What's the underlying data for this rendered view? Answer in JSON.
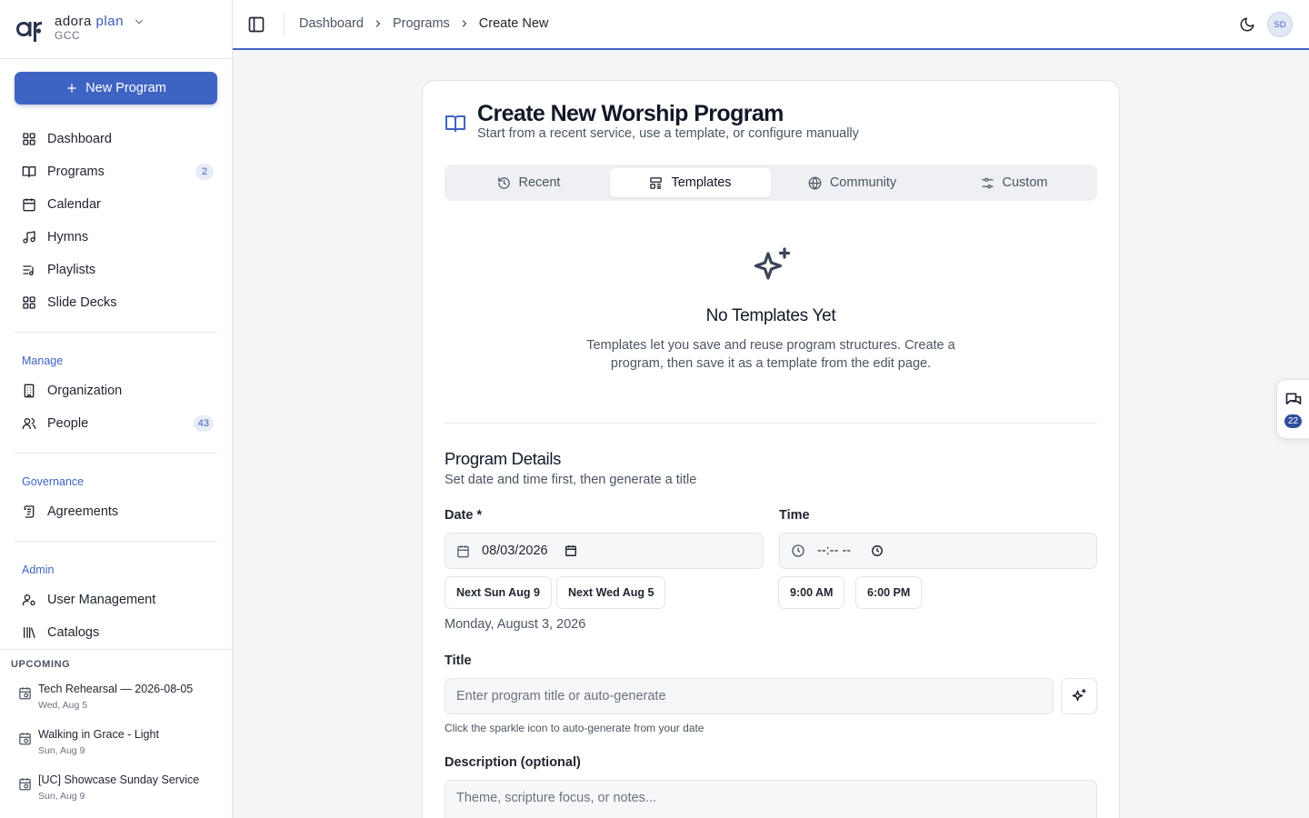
{
  "brand": {
    "name_main": "adora",
    "name_accent": "plan",
    "org": "GCC"
  },
  "sidebar": {
    "new_program": "New Program",
    "main_items": [
      {
        "label": "Dashboard",
        "icon": "grid-icon"
      },
      {
        "label": "Programs",
        "icon": "book-icon",
        "badge": "2"
      },
      {
        "label": "Calendar",
        "icon": "calendar-icon"
      },
      {
        "label": "Hymns",
        "icon": "music-icon"
      },
      {
        "label": "Playlists",
        "icon": "playlist-icon"
      },
      {
        "label": "Slide Decks",
        "icon": "grid-icon"
      }
    ],
    "manage_label": "Manage",
    "manage_items": [
      {
        "label": "Organization",
        "icon": "building-icon"
      },
      {
        "label": "People",
        "icon": "users-icon",
        "badge": "43"
      }
    ],
    "governance_label": "Governance",
    "governance_items": [
      {
        "label": "Agreements",
        "icon": "scroll-icon"
      }
    ],
    "admin_label": "Admin",
    "admin_items": [
      {
        "label": "User Management",
        "icon": "user-cog-icon"
      },
      {
        "label": "Catalogs",
        "icon": "library-icon"
      }
    ],
    "upcoming_label": "UPCOMING",
    "upcoming": [
      {
        "name": "Tech Rehearsal — 2026-08-05",
        "date": "Wed, Aug 5"
      },
      {
        "name": "Walking in Grace - Light",
        "date": "Sun, Aug 9"
      },
      {
        "name": "[UC] Showcase Sunday Service",
        "date": "Sun, Aug 9"
      }
    ]
  },
  "breadcrumb": [
    "Dashboard",
    "Programs",
    "Create New"
  ],
  "avatar_initials": "SD",
  "card": {
    "title": "Create New Worship Program",
    "subtitle": "Start from a recent service, use a template, or configure manually",
    "tabs": [
      {
        "label": "Recent",
        "icon": "history-icon"
      },
      {
        "label": "Templates",
        "icon": "template-icon",
        "active": true
      },
      {
        "label": "Community",
        "icon": "globe-icon"
      },
      {
        "label": "Custom",
        "icon": "sliders-icon"
      }
    ],
    "empty_title": "No Templates Yet",
    "empty_desc": "Templates let you save and reuse program structures. Create a program, then save it as a template from the edit page.",
    "details_title": "Program Details",
    "details_sub": "Set date and time first, then generate a title",
    "date_label": "Date *",
    "date_value": "08/03/2026",
    "time_label": "Time",
    "time_value": "--:-- --",
    "date_chips": [
      "Next Sun Aug 9",
      "Next Wed Aug 5"
    ],
    "time_chips": [
      "9:00 AM",
      "6:00 PM"
    ],
    "long_date": "Monday, August 3, 2026",
    "title_label": "Title",
    "title_placeholder": "Enter program title or auto-generate",
    "title_hint": "Click the sparkle icon to auto-generate from your date",
    "desc_label": "Description (optional)",
    "desc_placeholder": "Theme, scripture focus, or notes..."
  },
  "feedback_count": "22",
  "colors": {
    "accent": "#3f63c2",
    "text": "#1f2430",
    "muted": "#4b5563",
    "background": "#f4f5f7"
  }
}
